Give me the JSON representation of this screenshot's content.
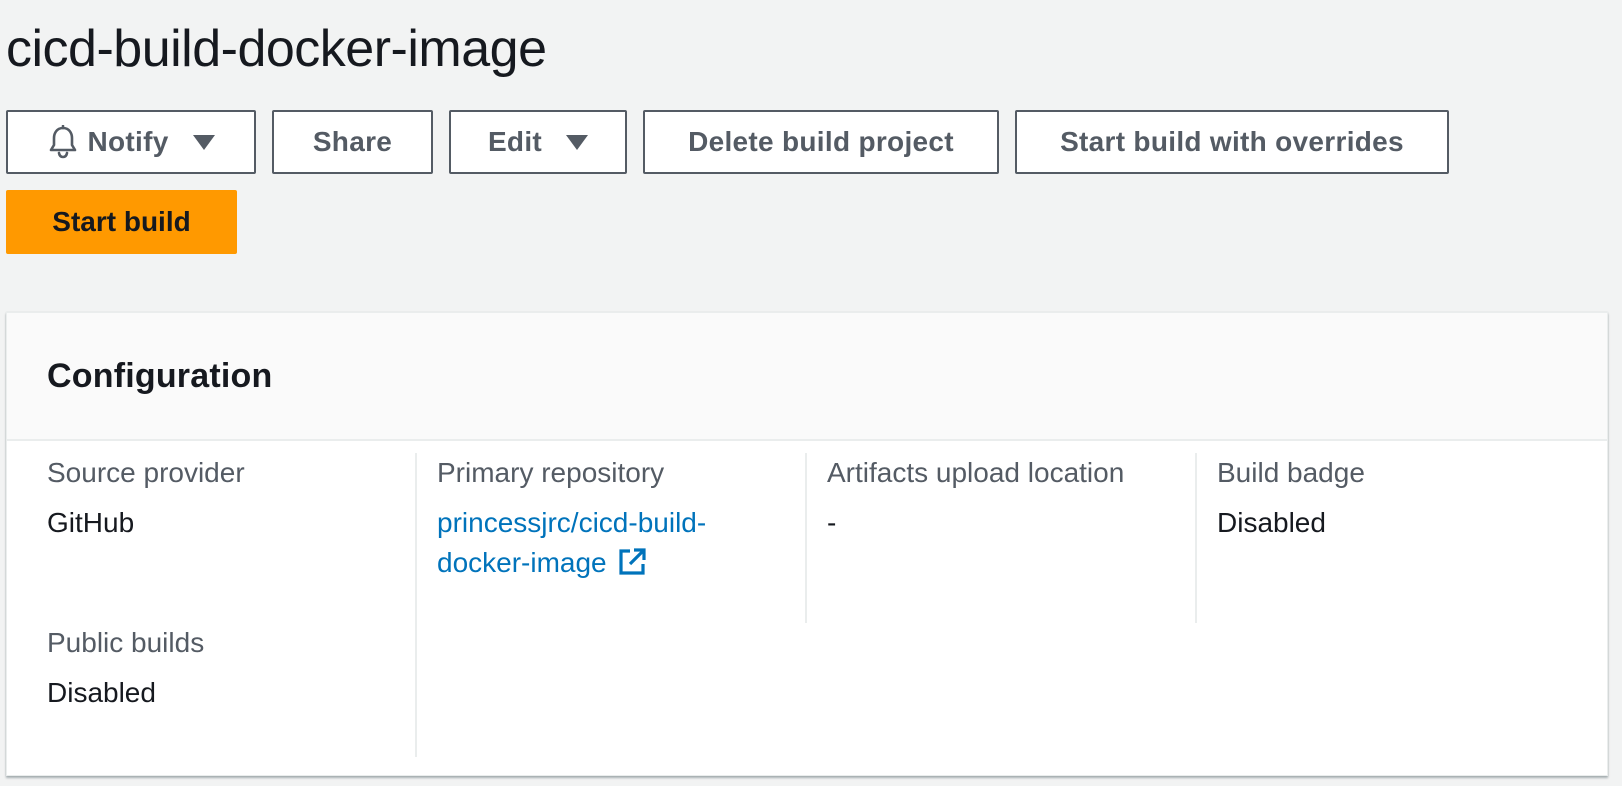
{
  "page": {
    "title": "cicd-build-docker-image"
  },
  "toolbar": {
    "notify_label": "Notify",
    "share_label": "Share",
    "edit_label": "Edit",
    "delete_label": "Delete build project",
    "start_overrides_label": "Start build with overrides",
    "start_build_label": "Start build"
  },
  "configuration": {
    "title": "Configuration",
    "source_provider": {
      "label": "Source provider",
      "value": "GitHub"
    },
    "public_builds": {
      "label": "Public builds",
      "value": "Disabled"
    },
    "primary_repository": {
      "label": "Primary repository",
      "value": "princessjrc/cicd-build-docker-image"
    },
    "artifacts_upload_location": {
      "label": "Artifacts upload location",
      "value": "-"
    },
    "build_badge": {
      "label": "Build badge",
      "value": "Disabled"
    }
  },
  "colors": {
    "primary_button": "#ff9900",
    "link": "#0073bb",
    "background": "#f2f3f3",
    "label": "#545b64"
  },
  "icons": {
    "notify": "bell-icon",
    "dropdown": "caret-down-icon",
    "external": "external-link-icon"
  }
}
